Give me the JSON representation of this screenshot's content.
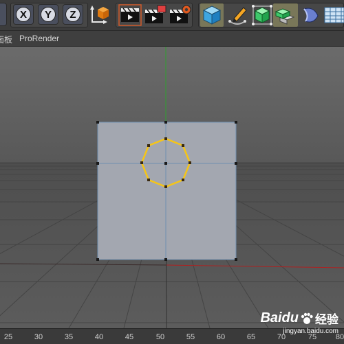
{
  "toolbar": {
    "axis_buttons": [
      {
        "label": "X",
        "icon": "x-axis-lock-icon"
      },
      {
        "label": "Y",
        "icon": "y-axis-lock-icon"
      },
      {
        "label": "Z",
        "icon": "z-axis-lock-icon"
      }
    ],
    "icons": [
      "coordinate-system-icon",
      "render-view-icon",
      "render-to-picture-viewer-icon",
      "render-settings-icon",
      "cube-icon",
      "pen-spline-icon",
      "subdivision-surface-icon",
      "array-icon",
      "deformer-icon",
      "floor-icon"
    ]
  },
  "menubar": {
    "left_fragment": "面板",
    "prorender": "ProRender"
  },
  "ruler": {
    "labels": [
      "25",
      "30",
      "35",
      "40",
      "45",
      "50",
      "55",
      "60",
      "65",
      "70",
      "75",
      "80"
    ]
  },
  "watermark": {
    "brand": "Baidu",
    "sub_brand": "经验",
    "url": "jingyan.baidu.com"
  },
  "colors": {
    "accent_selection": "#f5c518",
    "plane_fill": "#a3a7b0",
    "y_axis": "#2fa02f",
    "x_axis": "#b02020",
    "toolbar_bg": "#3c3c3c"
  }
}
